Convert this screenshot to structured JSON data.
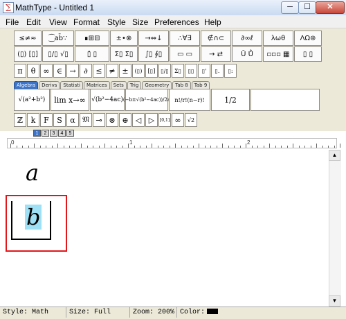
{
  "window": {
    "title": "MathType - Untitled 1",
    "controls": {
      "minimize": "─",
      "maximize": "☐",
      "close": "✕"
    }
  },
  "menu": [
    "File",
    "Edit",
    "View",
    "Format",
    "Style",
    "Size",
    "Preferences",
    "Help"
  ],
  "palettes": {
    "row1": [
      "≤≠≈",
      "⁐ab̄∵",
      "∎⊞⊟",
      "±•⊗",
      "→⇔↓",
      "∴∀∃",
      "∉∩⊂",
      "∂∞ℓ",
      "λωθ",
      "ΛΩ⊛"
    ],
    "row2": [
      "(▯) [▯]",
      "▯/▯ √▯",
      "▯̂ ▯",
      "Σ▯ Σ▯",
      "∫▯ ∮▯",
      "▭ ▭",
      "→ ⇄",
      "Ū Ů",
      "▫▫▫ ▦",
      "▯ ▯"
    ],
    "row3": [
      "π",
      "θ",
      "∞",
      "∈",
      "→",
      "∂",
      "≤",
      "≠",
      "±",
      "(▯)",
      "[▯]",
      "▯/▯",
      "Σ▯",
      "▯▯",
      "▯'",
      "▯.",
      "▯:"
    ],
    "tabs": [
      "Algebra",
      "Derivs",
      "Statisti",
      "Matrices",
      "Sets",
      "Trig",
      "Geometry",
      "Tab 8",
      "Tab 9"
    ],
    "templates": [
      "√(a²+b²)",
      "lim x→∞",
      "√(b²−4ac)",
      "(−b±√(b²−4ac))/2a",
      "n!/r!(n−r)!",
      "1/2"
    ],
    "row_bottom": [
      "ℤ",
      "k",
      "F",
      "S",
      "α",
      "𝔐",
      "⊸",
      "⊗",
      "⊕",
      "◁",
      "▷",
      "[0,1]",
      "∞",
      "√2"
    ]
  },
  "size_toolbar": [
    "1",
    "2",
    "3",
    "4",
    "5"
  ],
  "ruler": {
    "marks": [
      "0",
      "1",
      "2"
    ]
  },
  "equation": {
    "line1": "a",
    "line2": "b"
  },
  "status": {
    "style": "Style: Math",
    "size": "Size: Full",
    "zoom": "Zoom: 200%",
    "color_label": "Color:"
  },
  "colors": {
    "highlight_box": "#e0161b",
    "selection": "#9ee0f5",
    "active_tab": "#3b74c9"
  }
}
